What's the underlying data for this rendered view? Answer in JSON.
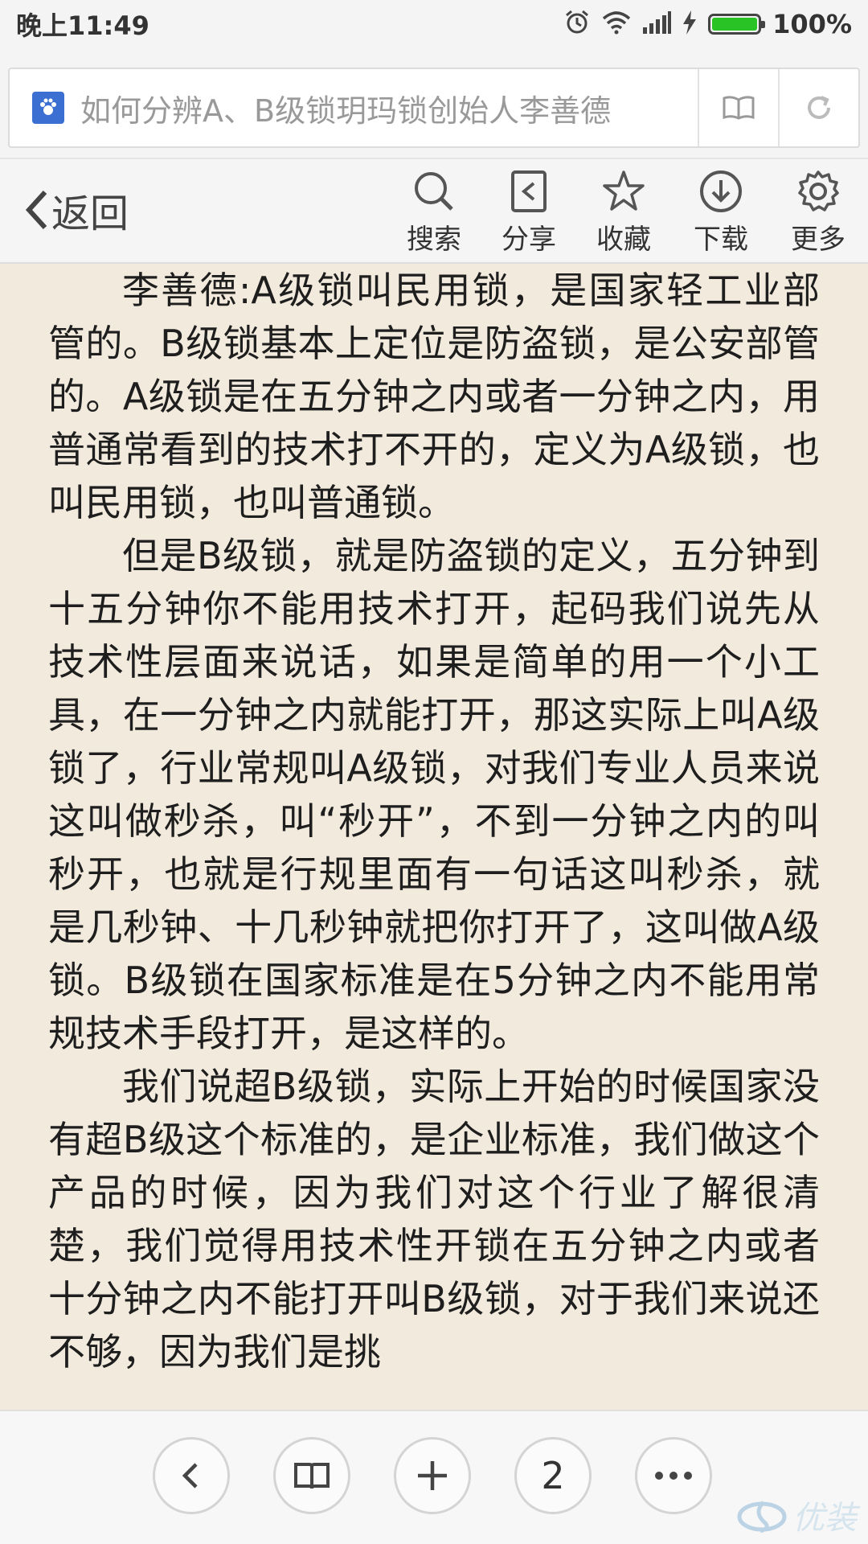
{
  "status_bar": {
    "time": "晚上11:49",
    "battery_text": "100%",
    "battery_level": 1.0,
    "icons": [
      "alarm-icon",
      "wifi-icon",
      "signal-icon",
      "charging-icon",
      "battery-icon"
    ]
  },
  "address_bar": {
    "page_title": "如何分辨A、B级锁玥玛锁创始人李善德"
  },
  "toolbar": {
    "back_label": "返回",
    "tools": [
      {
        "icon": "search-icon",
        "label": "搜索"
      },
      {
        "icon": "share-icon",
        "label": "分享"
      },
      {
        "icon": "star-icon",
        "label": "收藏"
      },
      {
        "icon": "download-icon",
        "label": "下载"
      },
      {
        "icon": "gear-icon",
        "label": "更多"
      }
    ]
  },
  "article": {
    "paragraphs": [
      "李善德:A级锁叫民用锁，是国家轻工业部管的。B级锁基本上定位是防盗锁，是公安部管的。A级锁是在五分钟之内或者一分钟之内，用普通常看到的技术打不开的，定义为A级锁，也叫民用锁，也叫普通锁。",
      "但是B级锁，就是防盗锁的定义，五分钟到十五分钟你不能用技术打开，起码我们说先从技术性层面来说话，如果是简单的用一个小工具，在一分钟之内就能打开，那这实际上叫A级锁了，行业常规叫A级锁，对我们专业人员来说这叫做秒杀，叫“秒开”，不到一分钟之内的叫秒开，也就是行规里面有一句话这叫秒杀，就是几秒钟、十几秒钟就把你打开了，这叫做A级锁。B级锁在国家标准是在5分钟之内不能用常规技术手段打开，是这样的。",
      "我们说超B级锁，实际上开始的时候国家没有超B级这个标准的，是企业标准，我们做这个产品的时候，因为我们对这个行业了解很清楚，我们觉得用技术性开锁在五分钟之内或者十分钟之内不能打开叫B级锁，对于我们来说还不够，因为我们是挑"
    ]
  },
  "bottom_nav": {
    "tab_count": "2",
    "buttons": [
      "back-icon",
      "book-icon",
      "plus-icon",
      "tab-count",
      "more-icon"
    ]
  },
  "watermark": {
    "text": "优装"
  },
  "colors": {
    "page_bg": "#f2eadc",
    "battery_green": "#29c325",
    "favicon_blue": "#3b6fd1"
  }
}
